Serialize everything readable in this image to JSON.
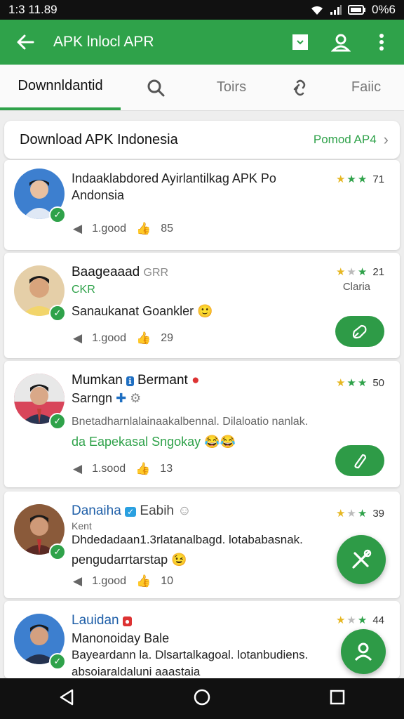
{
  "status_bar": {
    "time": "1:3 11.89",
    "battery": "0%6"
  },
  "app_bar": {
    "title": "APK lnlocl APR"
  },
  "tabs": [
    {
      "label": "Downnldantid"
    },
    {
      "label": "Toirs"
    },
    {
      "label": "Faiic"
    }
  ],
  "section": {
    "title": "Download APK Indonesia",
    "link": "Pomod AP4"
  },
  "cards": [
    {
      "name_line1": "Indaaklabdored Ayirlantilkag APK Po",
      "name_line2": "Andonsia",
      "rating": "71",
      "downloads": "1.good",
      "likes": "85"
    },
    {
      "name": "Baageaaad",
      "name_suffix": "GRR",
      "tag": "CKR",
      "sub_right": "Claria",
      "line": "Sanaukanat Goankler",
      "rating": "21",
      "downloads": "1.good",
      "likes": "29"
    },
    {
      "name": "Mumkan",
      "name_suffix": "Bermant",
      "line2": "Sarngn",
      "desc": "Bnetadharnlalainaakalbennal. Dilaloatio nanlak.",
      "line3": "da Eapekasal Sngokay",
      "rating": "50",
      "downloads": "1.sood",
      "likes": "13"
    },
    {
      "name": "Danaiha",
      "name_suffix": "Eabih",
      "line2": "Kent",
      "desc": "Dhdedadaan1.3rlatanalbagd. lotababasnak.",
      "line3": "pengudarrtarstap",
      "rating": "39",
      "downloads": "1.good",
      "likes": "10"
    },
    {
      "name": "Lauidan",
      "line2": "Manonoiday Bale",
      "desc": "Bayeardann la. Dlsartalkagoal. lotanbudiens.",
      "line3": "absoiaraldaluni aaastaia",
      "rating": "44"
    }
  ],
  "colors": {
    "accent": "#2fa24a",
    "status_bar": "#111111",
    "star": "#e6b722"
  }
}
